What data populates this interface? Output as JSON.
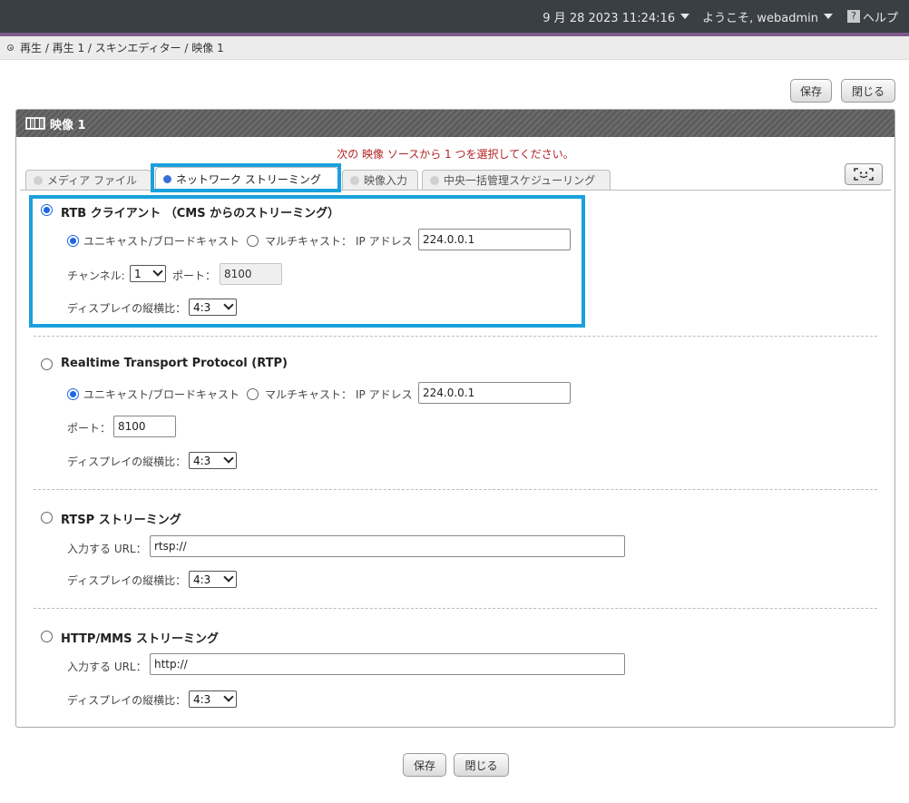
{
  "topbar": {
    "datetime": "9 月 28 2023 11:24:16",
    "welcome": "ようこそ, webadmin",
    "help_label": "ヘルプ",
    "help_icon": "?"
  },
  "breadcrumb": "再生 / 再生 1 / スキンエディター / 映像 1",
  "buttons": {
    "save": "保存",
    "close": "閉じる"
  },
  "panel": {
    "title": "映像 1",
    "instruction": "次の 映像 ソースから 1 つを選択してください。",
    "tabs": [
      {
        "label": "メディア ファイル",
        "active": false
      },
      {
        "label": "ネットワーク ストリーミング",
        "active": true
      },
      {
        "label": "映像入力",
        "active": false
      },
      {
        "label": "中央一括管理スケジューリング",
        "active": false
      }
    ]
  },
  "sections": {
    "rtb": {
      "title": "RTB クライアント （CMS からのストリーミング）",
      "selected": true,
      "unicast": "ユニキャスト/ブロードキャスト",
      "multicast": "マルチキャスト：",
      "ip_label": "IP アドレス",
      "ip_value": "224.0.0.1",
      "channel_label": "チャンネル:",
      "channel_value": "1",
      "port_label": "ポート：",
      "port_value": "8100",
      "aspect_label": "ディスプレイの縦横比：",
      "aspect_value": "4:3"
    },
    "rtp": {
      "title": "Realtime Transport Protocol (RTP)",
      "selected": false,
      "unicast": "ユニキャスト/ブロードキャスト",
      "multicast": "マルチキャスト：",
      "ip_label": "IP アドレス",
      "ip_value": "224.0.0.1",
      "port_label": "ポート：",
      "port_value": "8100",
      "aspect_label": "ディスプレイの縦横比：",
      "aspect_value": "4:3"
    },
    "rtsp": {
      "title": "RTSP ストリーミング",
      "selected": false,
      "url_label": "入力する URL：",
      "url_value": "rtsp://",
      "aspect_label": "ディスプレイの縦横比：",
      "aspect_value": "4:3"
    },
    "http": {
      "title": "HTTP/MMS ストリーミング",
      "selected": false,
      "url_label": "入力する URL：",
      "url_value": "http://",
      "aspect_label": "ディスプレイの縦横比：",
      "aspect_value": "4:3"
    }
  },
  "colors": {
    "highlight": "#1aa0dc",
    "radio_selected": "#1f66e5",
    "instruction": "#b22222"
  }
}
